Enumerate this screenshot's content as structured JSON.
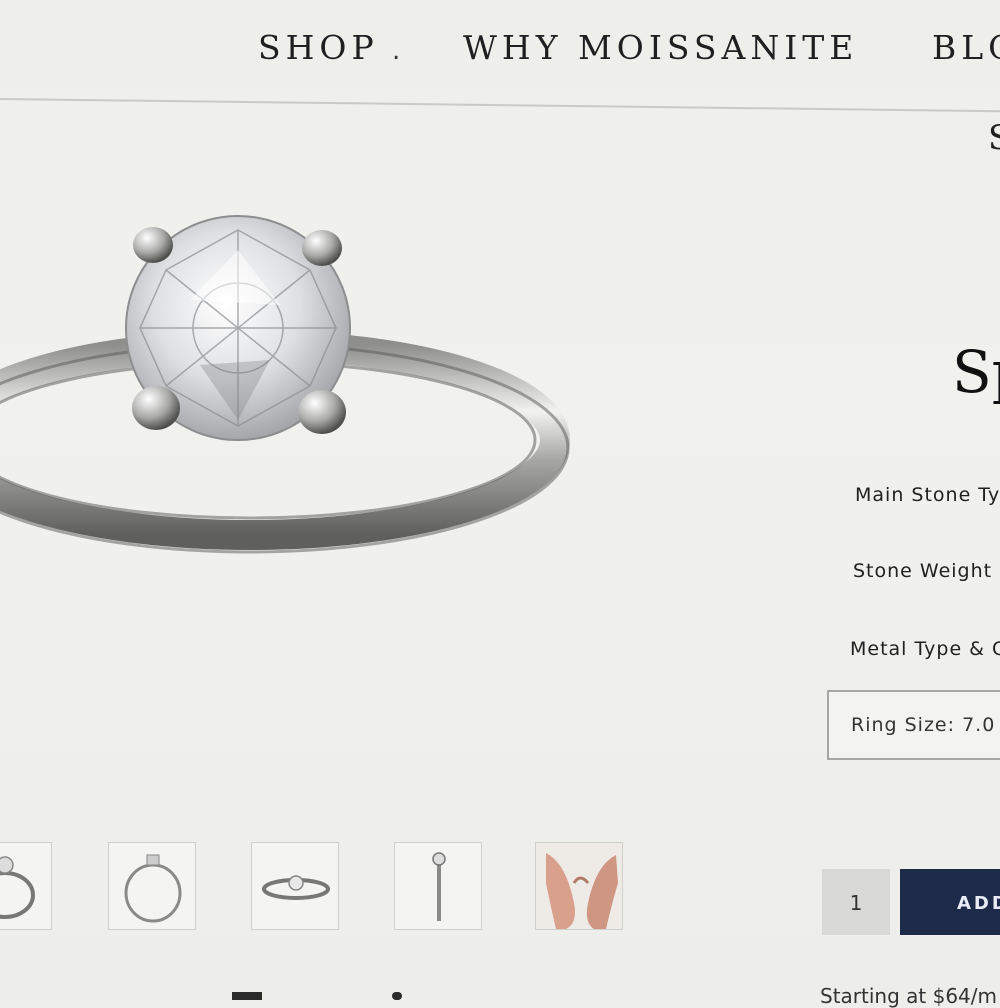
{
  "nav": {
    "items": [
      "SHOP",
      "WHY MOISSANITE",
      "BLO"
    ],
    "separator": "."
  },
  "header_partial": "S",
  "product": {
    "title_partial": "Sp",
    "options": {
      "main_stone_label": "Main Stone Ty",
      "stone_weight_label": "Stone Weight",
      "metal_type_label": "Metal Type & C",
      "ring_size_value": "Ring Size: 7.0"
    },
    "quantity": "1",
    "add_button_label": "ADD",
    "price_text": "Starting at $64/m"
  },
  "thumbnails": [
    "ring-front-thumb",
    "ring-side-upright-thumb",
    "ring-angle-thumb",
    "ring-profile-thumb",
    "hands-wearing-ring-thumb"
  ],
  "colors": {
    "nav_text": "#1f1f22",
    "add_button_bg": "#1e2a4a",
    "add_button_text": "#e9ecf4",
    "quantity_bg": "#d9d9d8",
    "background": "#efefec"
  }
}
